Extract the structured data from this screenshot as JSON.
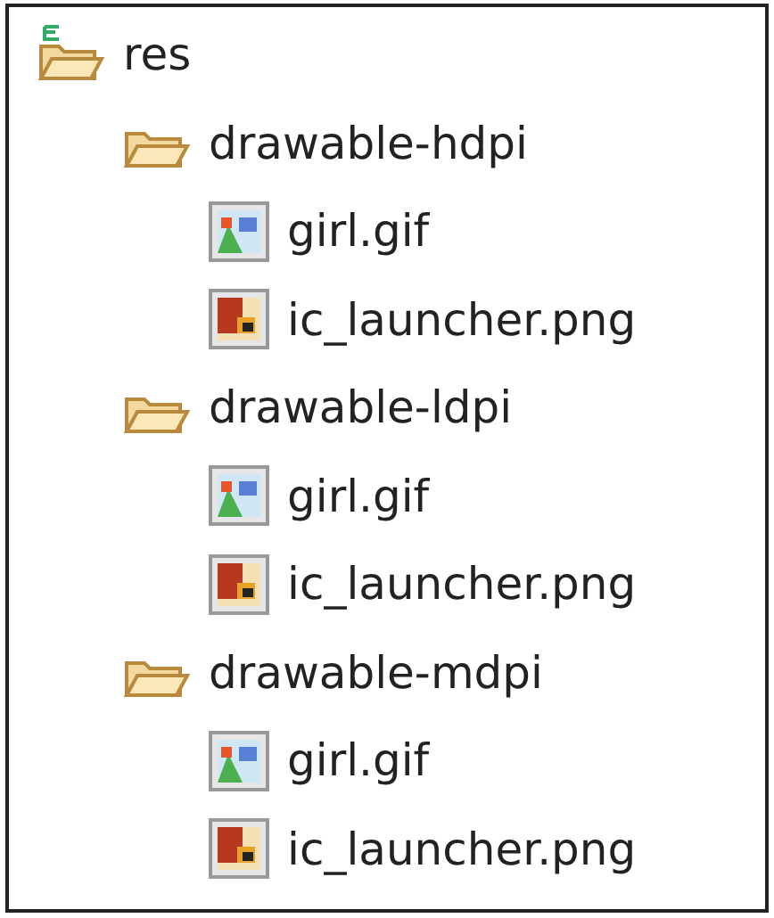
{
  "tree": [
    {
      "label": "res",
      "kind": "source-folder",
      "children": [
        {
          "label": "drawable-hdpi",
          "kind": "folder",
          "children": [
            {
              "label": "girl.gif",
              "kind": "image"
            },
            {
              "label": "ic_launcher.png",
              "kind": "png"
            }
          ]
        },
        {
          "label": "drawable-ldpi",
          "kind": "folder",
          "children": [
            {
              "label": "girl.gif",
              "kind": "image"
            },
            {
              "label": "ic_launcher.png",
              "kind": "png"
            }
          ]
        },
        {
          "label": "drawable-mdpi",
          "kind": "folder",
          "children": [
            {
              "label": "girl.gif",
              "kind": "image"
            },
            {
              "label": "ic_launcher.png",
              "kind": "png"
            }
          ]
        }
      ]
    }
  ]
}
